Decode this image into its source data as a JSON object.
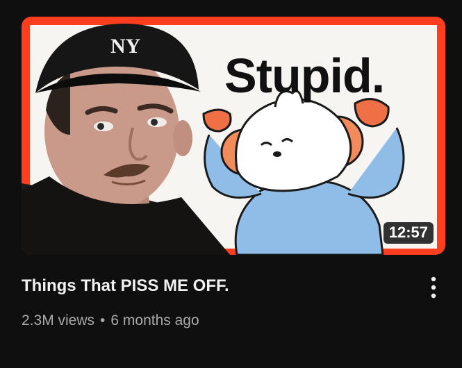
{
  "video": {
    "thumbnail_text": "Stupid.",
    "duration": "12:57",
    "title": "Things That PISS ME OFF.",
    "views": "2.3M views",
    "separator": "•",
    "age": "6 months ago"
  },
  "icons": {
    "menu": "more-vertical-icon"
  },
  "colors": {
    "background": "#0f0f0f",
    "thumbnail_border": "#ff3d1f",
    "title": "#f1f1f1",
    "meta": "#aaaaaa"
  }
}
